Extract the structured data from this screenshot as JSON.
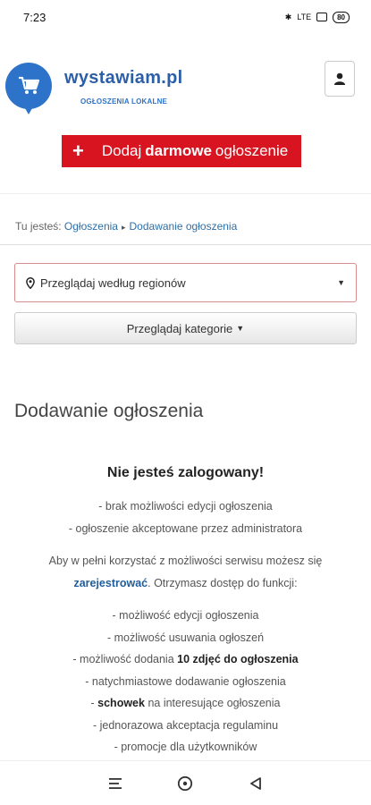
{
  "status": {
    "time": "7:23",
    "signal_text": "LTE",
    "battery": "80"
  },
  "header": {
    "brand": "wystawiam.pl",
    "tagline": "OGŁOSZENIA LOKALNE"
  },
  "add_button": {
    "prefix": "Dodaj",
    "bold": "darmowe",
    "suffix": "ogłoszenie"
  },
  "breadcrumb": {
    "prefix": "Tu jesteś:",
    "items": [
      "Ogłoszenia",
      "Dodawanie ogłoszenia"
    ]
  },
  "regions": {
    "label": "Przeglądaj według regionów"
  },
  "categories": {
    "label": "Przeglądaj kategorie"
  },
  "page_title": "Dodawanie ogłoszenia",
  "content": {
    "notice": "Nie jesteś zalogowany!",
    "limits": [
      "- brak możliwości edycji ogłoszenia",
      "- ogłoszenie akceptowane przez administratora"
    ],
    "intro_1": "Aby w pełni korzystać z możliwości serwisu możesz się",
    "register_link": "zarejestrować",
    "intro_2": ". Otrzymasz dostęp do funkcji:",
    "features": {
      "f1": "- możliwość edycji ogłoszenia",
      "f2": "- możliwość usuwania ogłoszeń",
      "f3_pre": "- możliwość dodania",
      "f3_bold": "10 zdjęć do ogłoszenia",
      "f4": "- natychmiastowe dodawanie ogłoszenia",
      "f5_pre": "-",
      "f5_bold": "schowek",
      "f5_post": "na interesujące ogłoszenia",
      "f6": "- jednorazowa akceptacja regulaminu",
      "f7": "- promocje dla użytkowników"
    }
  },
  "colors": {
    "brand_blue": "#2d73c9",
    "cta_red": "#d7141f",
    "link": "#2d6fa8"
  }
}
